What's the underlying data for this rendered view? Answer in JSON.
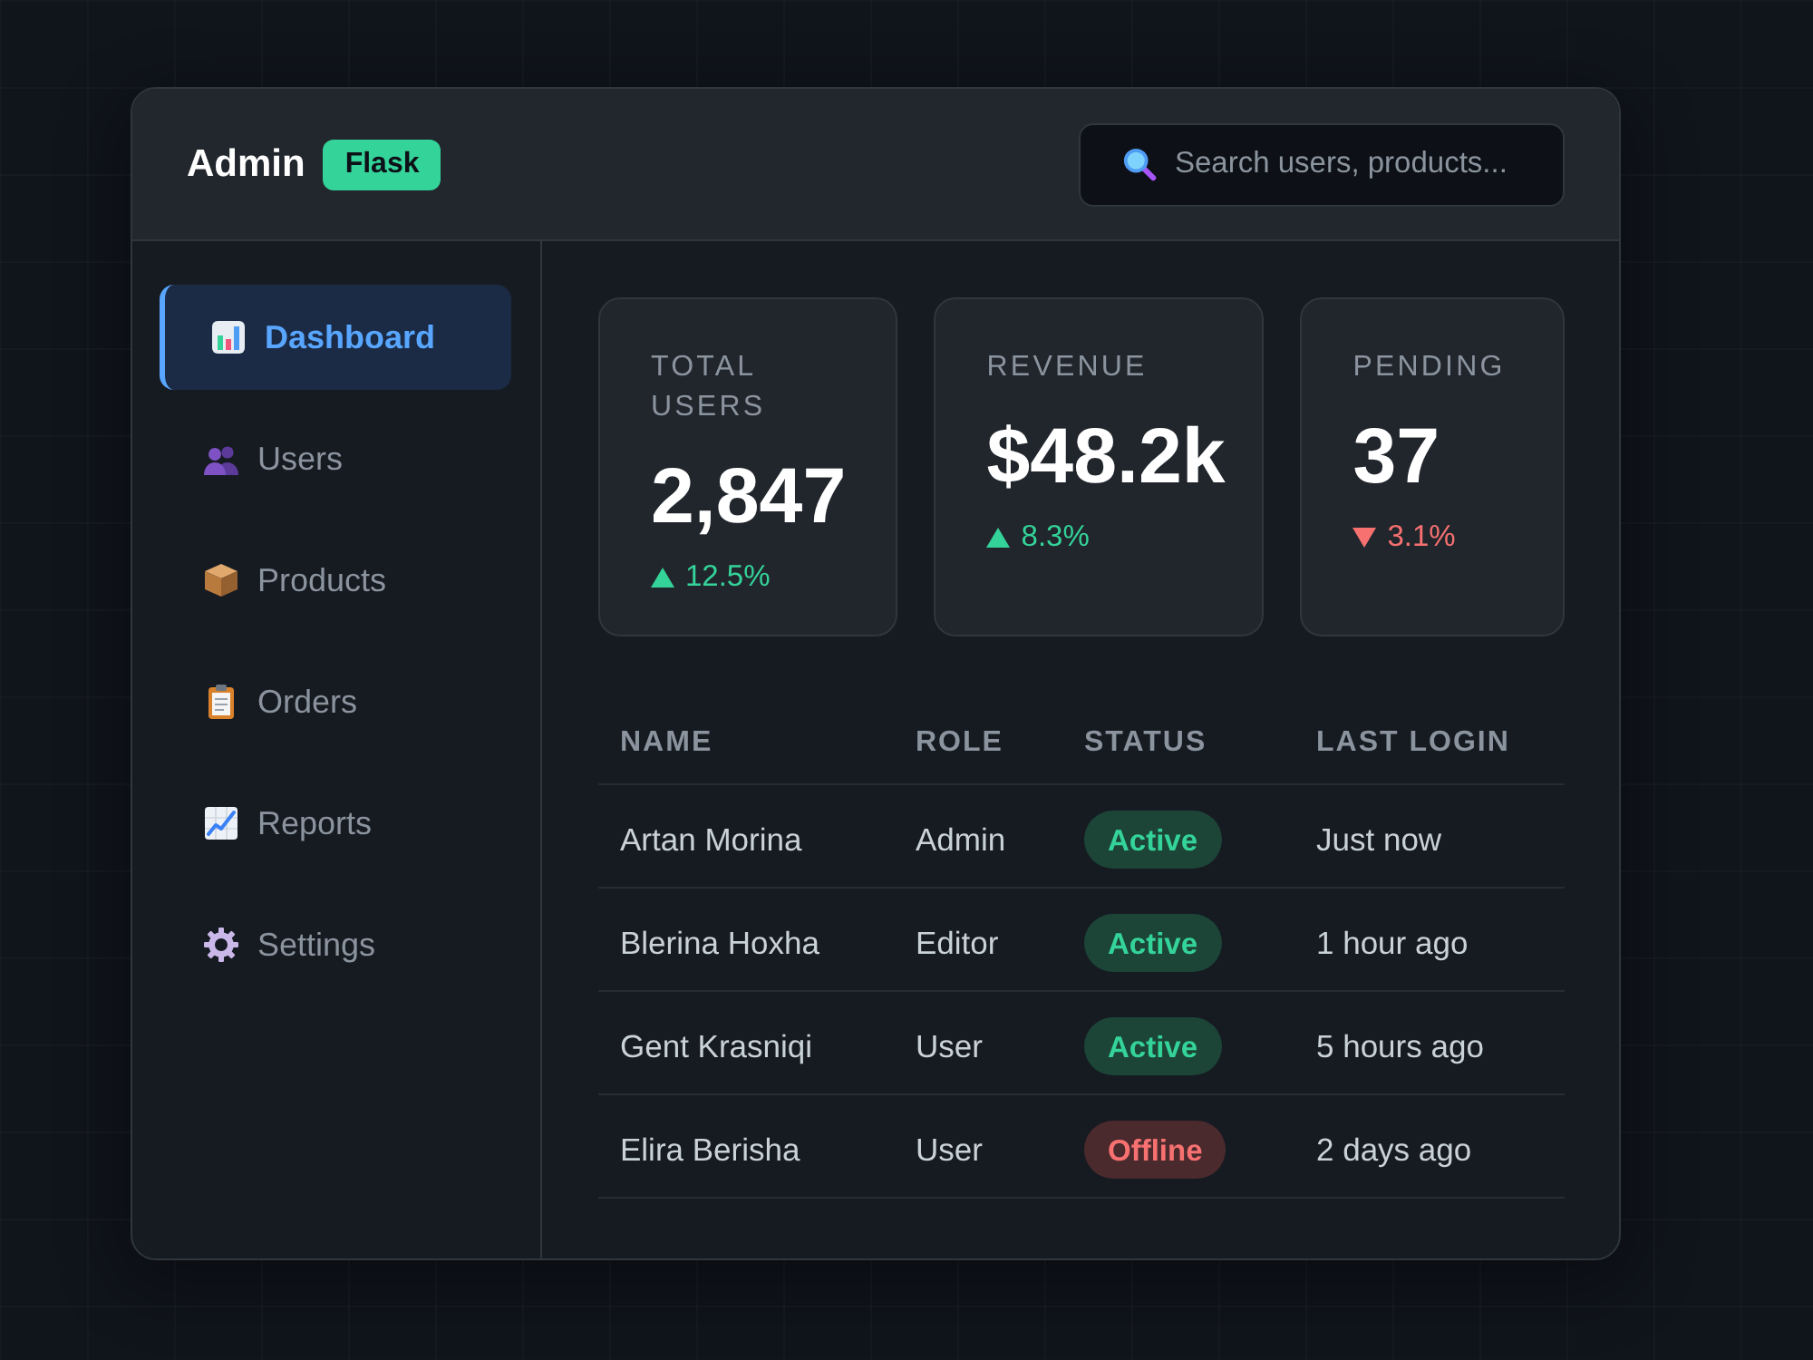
{
  "header": {
    "title": "Admin",
    "badge": "Flask",
    "search": {
      "placeholder": "Search users, products..."
    }
  },
  "sidebar": {
    "items": [
      {
        "label": "Dashboard",
        "selected": true
      },
      {
        "label": "Users",
        "selected": false
      },
      {
        "label": "Products",
        "selected": false
      },
      {
        "label": "Orders",
        "selected": false
      },
      {
        "label": "Reports",
        "selected": false
      },
      {
        "label": "Settings",
        "selected": false
      }
    ]
  },
  "stats": [
    {
      "label": "TOTAL USERS",
      "value": "2,847",
      "trend": {
        "text": "12.5%",
        "rising": true
      }
    },
    {
      "label": "REVENUE",
      "value": "$48.2k",
      "trend": {
        "text": "8.3%",
        "rising": true
      }
    },
    {
      "label": "PENDING",
      "value": "37",
      "trend": {
        "text": "3.1%",
        "rising": false
      }
    }
  ],
  "table": {
    "columns": [
      "NAME",
      "ROLE",
      "STATUS",
      "LAST LOGIN"
    ],
    "rows": [
      {
        "name": "Artan Morina",
        "role": "Admin",
        "status": {
          "label": "Active",
          "kind": "active"
        },
        "last_login": "Just now"
      },
      {
        "name": "Blerina Hoxha",
        "role": "Editor",
        "status": {
          "label": "Active",
          "kind": "active"
        },
        "last_login": "1 hour ago"
      },
      {
        "name": "Gent Krasniqi",
        "role": "User",
        "status": {
          "label": "Active",
          "kind": "active"
        },
        "last_login": "5 hours ago"
      },
      {
        "name": "Elira Berisha",
        "role": "User",
        "status": {
          "label": "Offline",
          "kind": "offline"
        },
        "last_login": "2 days ago"
      }
    ]
  }
}
